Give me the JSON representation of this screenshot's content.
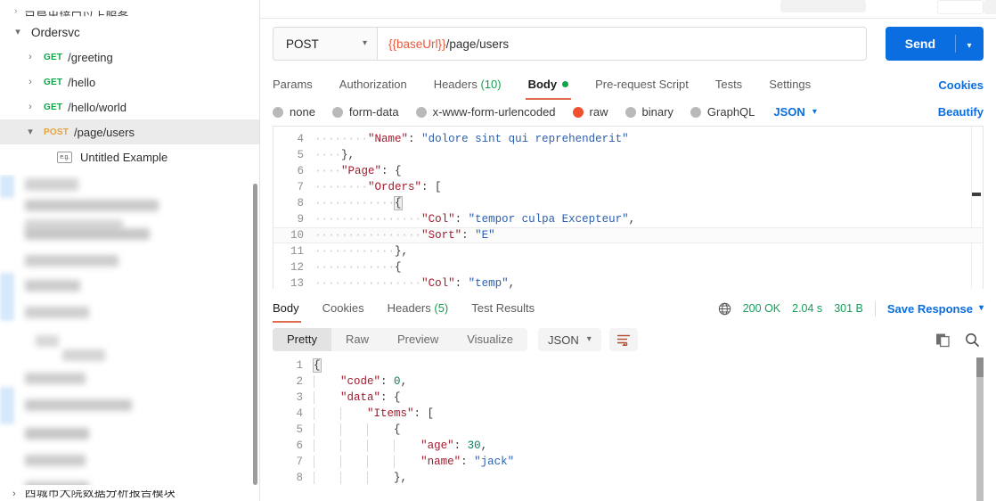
{
  "sidebar": {
    "cut_top_text": "已导出接口以上服务",
    "collection": {
      "name": "Ordersvc",
      "caret": "chevron-down-icon"
    },
    "requests": [
      {
        "caret": "chevron-right-icon",
        "method": "GET",
        "path": "/greeting",
        "selected": false
      },
      {
        "caret": "chevron-right-icon",
        "method": "GET",
        "path": "/hello",
        "selected": false
      },
      {
        "caret": "chevron-right-icon",
        "method": "GET",
        "path": "/hello/world",
        "selected": false
      },
      {
        "caret": "chevron-down-icon",
        "method": "POST",
        "path": "/page/users",
        "selected": true
      }
    ],
    "example": {
      "badge": "e.g.",
      "label": "Untitled Example"
    },
    "cut_bottom_text": "西城市大院数据分析报告模块"
  },
  "request": {
    "method": "POST",
    "url_variable": "{{baseUrl}}",
    "url_path": "/page/users",
    "send_label": "Send",
    "tabs": [
      {
        "label": "Params",
        "active": false
      },
      {
        "label": "Authorization",
        "active": false
      },
      {
        "label": "Headers",
        "count": "(10)",
        "active": false
      },
      {
        "label": "Body",
        "active": true,
        "dot": true
      },
      {
        "label": "Pre-request Script",
        "active": false
      },
      {
        "label": "Tests",
        "active": false
      },
      {
        "label": "Settings",
        "active": false
      }
    ],
    "cookies_label": "Cookies",
    "body_types": [
      {
        "label": "none",
        "active": false
      },
      {
        "label": "form-data",
        "active": false
      },
      {
        "label": "x-www-form-urlencoded",
        "active": false
      },
      {
        "label": "raw",
        "active": true
      },
      {
        "label": "binary",
        "active": false
      },
      {
        "label": "GraphQL",
        "active": false
      }
    ],
    "format": "JSON",
    "beautify_label": "Beautify",
    "code_lines": [
      {
        "no": "4",
        "indent": 2,
        "guides": 2,
        "tokens": [
          {
            "t": "k",
            "v": "\"Name\""
          },
          {
            "t": "p",
            "v": ": "
          },
          {
            "t": "s",
            "v": "\"dolore sint qui reprehenderit\""
          }
        ]
      },
      {
        "no": "5",
        "indent": 1,
        "guides": 1,
        "tokens": [
          {
            "t": "p",
            "v": "},"
          }
        ]
      },
      {
        "no": "6",
        "indent": 1,
        "guides": 1,
        "tokens": [
          {
            "t": "k",
            "v": "\"Page\""
          },
          {
            "t": "p",
            "v": ": {"
          }
        ]
      },
      {
        "no": "7",
        "indent": 2,
        "guides": 2,
        "tokens": [
          {
            "t": "k",
            "v": "\"Orders\""
          },
          {
            "t": "p",
            "v": ": ["
          }
        ]
      },
      {
        "no": "8",
        "indent": 3,
        "guides": 3,
        "tokens": [
          {
            "t": "cur",
            "v": "{"
          }
        ]
      },
      {
        "no": "9",
        "indent": 4,
        "guides": 4,
        "tokens": [
          {
            "t": "k",
            "v": "\"Col\""
          },
          {
            "t": "p",
            "v": ": "
          },
          {
            "t": "s",
            "v": "\"tempor culpa Excepteur\""
          },
          {
            "t": "p",
            "v": ","
          }
        ]
      },
      {
        "no": "10",
        "indent": 4,
        "guides": 4,
        "highlight": true,
        "tokens": [
          {
            "t": "k",
            "v": "\"Sort\""
          },
          {
            "t": "p",
            "v": ": "
          },
          {
            "t": "s",
            "v": "\"E\""
          }
        ]
      },
      {
        "no": "11",
        "indent": 3,
        "guides": 3,
        "tokens": [
          {
            "t": "p",
            "v": "},"
          }
        ]
      },
      {
        "no": "12",
        "indent": 3,
        "guides": 3,
        "tokens": [
          {
            "t": "p",
            "v": "{"
          }
        ]
      },
      {
        "no": "13",
        "indent": 4,
        "guides": 4,
        "tokens": [
          {
            "t": "k",
            "v": "\"Col\""
          },
          {
            "t": "p",
            "v": ": "
          },
          {
            "t": "s",
            "v": "\"temp\""
          },
          {
            "t": "p",
            "v": ","
          }
        ]
      }
    ]
  },
  "response": {
    "tabs": [
      {
        "label": "Body",
        "active": true
      },
      {
        "label": "Cookies",
        "active": false
      },
      {
        "label": "Headers",
        "count": "(5)",
        "active": false
      },
      {
        "label": "Test Results",
        "active": false
      }
    ],
    "status": "200 OK",
    "time": "2.04 s",
    "size": "301 B",
    "save_label": "Save Response",
    "view_modes": [
      {
        "label": "Pretty",
        "active": true
      },
      {
        "label": "Raw",
        "active": false
      },
      {
        "label": "Preview",
        "active": false
      },
      {
        "label": "Visualize",
        "active": false
      }
    ],
    "format": "JSON",
    "icons": {
      "globe": "globe-icon",
      "copy": "copy-icon",
      "search": "search-icon",
      "wrap": "wrap-lines-icon"
    },
    "code_lines": [
      {
        "no": "1",
        "indent": 0,
        "guides": 0,
        "tokens": [
          {
            "t": "cur",
            "v": "{"
          }
        ]
      },
      {
        "no": "2",
        "indent": 1,
        "guides": 1,
        "tokens": [
          {
            "t": "k",
            "v": "\"code\""
          },
          {
            "t": "p",
            "v": ": "
          },
          {
            "t": "n",
            "v": "0"
          },
          {
            "t": "p",
            "v": ","
          }
        ]
      },
      {
        "no": "3",
        "indent": 1,
        "guides": 1,
        "tokens": [
          {
            "t": "k",
            "v": "\"data\""
          },
          {
            "t": "p",
            "v": ": {"
          }
        ]
      },
      {
        "no": "4",
        "indent": 2,
        "guides": 2,
        "tokens": [
          {
            "t": "k",
            "v": "\"Items\""
          },
          {
            "t": "p",
            "v": ": ["
          }
        ]
      },
      {
        "no": "5",
        "indent": 3,
        "guides": 3,
        "tokens": [
          {
            "t": "p",
            "v": "{"
          }
        ]
      },
      {
        "no": "6",
        "indent": 4,
        "guides": 4,
        "tokens": [
          {
            "t": "k",
            "v": "\"age\""
          },
          {
            "t": "p",
            "v": ": "
          },
          {
            "t": "n",
            "v": "30"
          },
          {
            "t": "p",
            "v": ","
          }
        ]
      },
      {
        "no": "7",
        "indent": 4,
        "guides": 4,
        "tokens": [
          {
            "t": "k",
            "v": "\"name\""
          },
          {
            "t": "p",
            "v": ": "
          },
          {
            "t": "s",
            "v": "\"jack\""
          }
        ]
      },
      {
        "no": "8",
        "indent": 3,
        "guides": 3,
        "tokens": [
          {
            "t": "p",
            "v": "},"
          }
        ]
      }
    ]
  },
  "colors": {
    "accent_blue": "#0b6ee0",
    "get_green": "#10a54a",
    "post_orange": "#e8a33d",
    "raw_orange": "#f1502f",
    "tab_underline": "#e06c4f",
    "status_green": "#13a05a"
  }
}
